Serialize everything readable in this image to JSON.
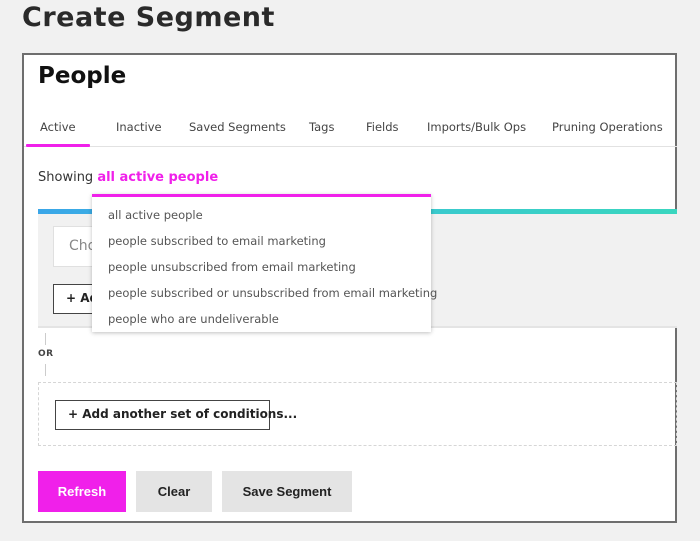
{
  "page": {
    "title": "Create Segment"
  },
  "panel": {
    "title": "People",
    "tabs": [
      {
        "label": "Active",
        "active": true
      },
      {
        "label": "Inactive",
        "active": false
      },
      {
        "label": "Saved Segments",
        "active": false
      },
      {
        "label": "Tags",
        "active": false
      },
      {
        "label": "Fields",
        "active": false
      },
      {
        "label": "Imports/Bulk Ops",
        "active": false
      },
      {
        "label": "Pruning Operations",
        "active": false
      }
    ],
    "showing": {
      "prefix": "Showing",
      "selected": "all active people"
    },
    "dropdown": {
      "options": [
        "all active people",
        "people subscribed to email marketing",
        "people unsubscribed from email marketing",
        "people subscribed or unsubscribed from email marketing",
        "people who are undeliverable"
      ]
    },
    "conditions": {
      "choose_placeholder": "Choose...",
      "add_condition_label": "+ Add condition",
      "or_label": "OR",
      "add_set_label": "+ Add another set of conditions..."
    },
    "actions": {
      "refresh": "Refresh",
      "clear": "Clear",
      "save": "Save Segment"
    }
  },
  "colors": {
    "accent": "#f020ea",
    "bar_start": "#3aa6e8",
    "bar_end": "#3ad6bf",
    "background": "#f1f1f1"
  }
}
